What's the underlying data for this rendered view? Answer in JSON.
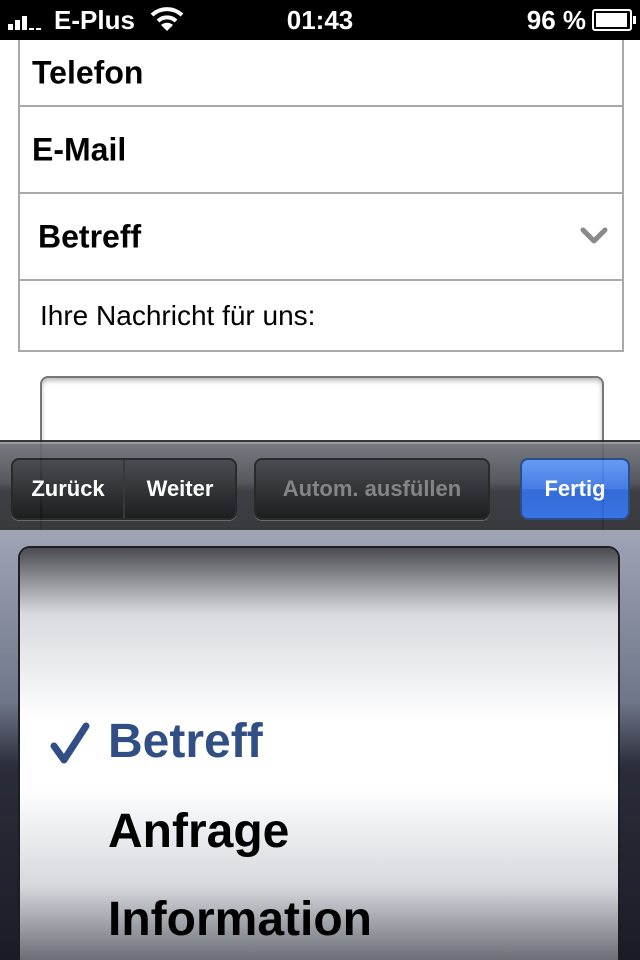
{
  "status_bar": {
    "carrier": "E-Plus",
    "time": "01:43",
    "battery_percent": "96 %",
    "battery_level": 0.96,
    "signal_bars": 3,
    "icons": [
      "signal-icon",
      "wifi-icon",
      "battery-icon"
    ]
  },
  "form": {
    "phone_label": "Telefon",
    "email_label": "E-Mail",
    "subject_label": "Betreff",
    "message_label": "Ihre Nachricht für uns:",
    "message_value": ""
  },
  "toolbar": {
    "back_label": "Zurück",
    "next_label": "Weiter",
    "autofill_label": "Autom. ausfüllen",
    "done_label": "Fertig"
  },
  "picker": {
    "selected": "Betreff",
    "options": [
      "Betreff",
      "Anfrage",
      "Information"
    ]
  },
  "colors": {
    "selected_option": "#324f85",
    "done_button": "#3a74e3"
  }
}
